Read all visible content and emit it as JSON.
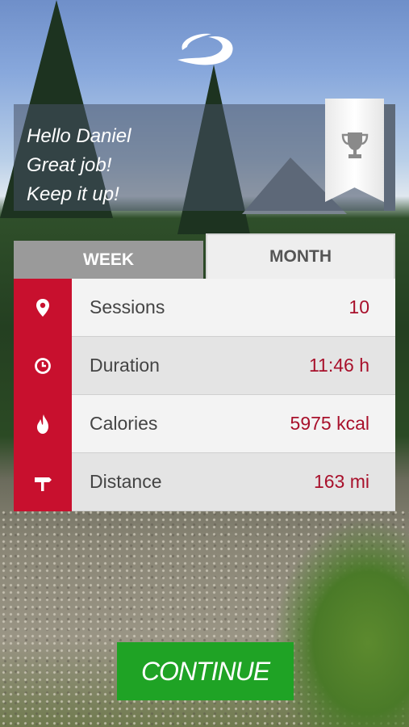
{
  "greeting": {
    "line1": "Hello Daniel",
    "line2": "Great job!",
    "line3": "Keep it up!"
  },
  "tabs": [
    {
      "label": "WEEK",
      "active": false
    },
    {
      "label": "MONTH",
      "active": true
    }
  ],
  "stats": [
    {
      "icon": "map-pin-icon",
      "label": "Sessions",
      "value": "10"
    },
    {
      "icon": "clock-icon",
      "label": "Duration",
      "value": "11:46 h"
    },
    {
      "icon": "flame-icon",
      "label": "Calories",
      "value": "5975 kcal"
    },
    {
      "icon": "signpost-icon",
      "label": "Distance",
      "value": "163 mi"
    }
  ],
  "continue_label": "CONTINUE",
  "colors": {
    "accent_red": "#c8102e",
    "value_red": "#a8102b",
    "continue_green": "#1fa325"
  }
}
